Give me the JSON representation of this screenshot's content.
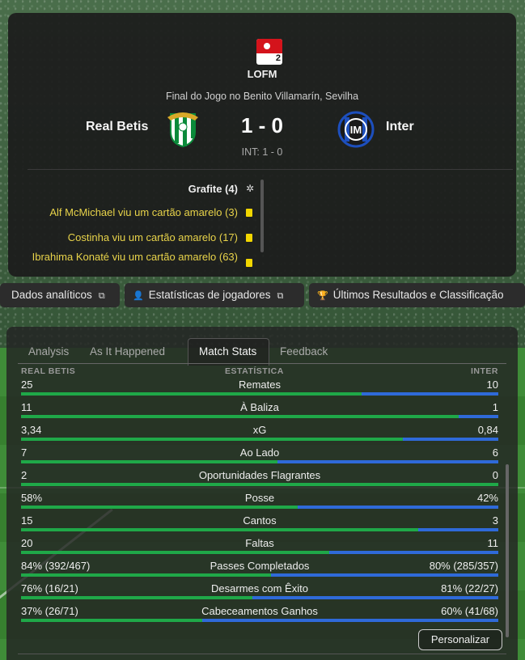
{
  "match": {
    "competition": "LOFM",
    "venue": "Final do Jogo no Benito Villamarín, Sevilha",
    "home_team": "Real Betis",
    "away_team": "Inter",
    "score": "1 - 0",
    "aggregate": "INT: 1 - 0",
    "logo_number": "2"
  },
  "events": {
    "section": "Grafite (4)",
    "items": [
      "Alf McMichael viu um cartão amarelo (3)",
      "Costinha viu um cartão amarelo (17)",
      "Ibrahima Konaté viu um cartão amarelo (63)"
    ]
  },
  "buttons": {
    "analytics": "Dados analíticos",
    "player_stats": "Estatísticas de jogadores",
    "results": "Últimos Resultados e Classificação"
  },
  "tabs": [
    "Analysis",
    "As It Happened",
    "Match Stats",
    "Feedback"
  ],
  "stats": {
    "header_home": "REAL BETIS",
    "header_label": "ESTATÍSTICA",
    "header_away": "INTER",
    "rows": [
      {
        "label": "Remates",
        "home": "25",
        "away": "10",
        "home_share": 0.714
      },
      {
        "label": "À Baliza",
        "home": "11",
        "away": "1",
        "home_share": 0.917
      },
      {
        "label": "xG",
        "home": "3,34",
        "away": "0,84",
        "home_share": 0.8
      },
      {
        "label": "Ao Lado",
        "home": "7",
        "away": "6",
        "home_share": 0.538
      },
      {
        "label": "Oportunidades Flagrantes",
        "home": "2",
        "away": "0",
        "home_share": 1.0
      },
      {
        "label": "Posse",
        "home": "58%",
        "away": "42%",
        "home_share": 0.58
      },
      {
        "label": "Cantos",
        "home": "15",
        "away": "3",
        "home_share": 0.833
      },
      {
        "label": "Faltas",
        "home": "20",
        "away": "11",
        "home_share": 0.645
      },
      {
        "label": "Passes Completados",
        "home": "84% (392/467)",
        "away": "80% (285/357)",
        "home_share": 0.524
      },
      {
        "label": "Desarmes com Êxito",
        "home": "76% (16/21)",
        "away": "81% (22/27)",
        "home_share": 0.485
      },
      {
        "label": "Cabeceamentos Ganhos",
        "home": "37% (26/71)",
        "away": "60% (41/68)",
        "home_share": 0.38
      }
    ]
  },
  "customize_label": "Personalizar",
  "colors": {
    "home_bar": "#1fa848",
    "away_bar": "#2f6ad9",
    "yellow_card": "#f2d600",
    "event_text": "#e8d34a"
  },
  "icons": {
    "section": "football-icon",
    "card": "yellow-card-icon",
    "external": "external-link-icon",
    "player": "person-icon",
    "trophy": "trophy-icon"
  }
}
